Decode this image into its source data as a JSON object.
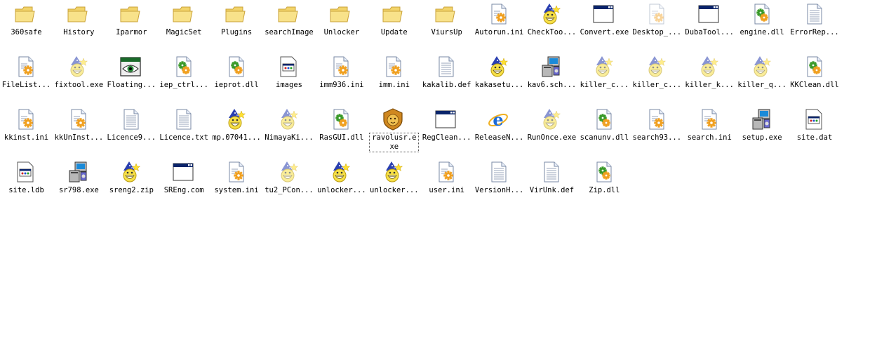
{
  "colors": {
    "folder": "#f2d46a",
    "folder_dark": "#c9a238",
    "window_title": "#0a246a",
    "doc_border": "#7a8aa6",
    "gear": "#f0a020",
    "dll_green": "#3a9a2a",
    "wizard_hat": "#2a3fb0",
    "wizard_face": "#f7e046"
  },
  "items": [
    {
      "label": "360safe",
      "icon": "folder-icon",
      "selected": false
    },
    {
      "label": "History",
      "icon": "folder-icon",
      "selected": false
    },
    {
      "label": "Iparmor",
      "icon": "folder-icon",
      "selected": false
    },
    {
      "label": "MagicSet",
      "icon": "folder-icon",
      "selected": false
    },
    {
      "label": "Plugins",
      "icon": "folder-icon",
      "selected": false
    },
    {
      "label": "searchImage",
      "icon": "folder-icon",
      "selected": false
    },
    {
      "label": "Unlocker",
      "icon": "folder-icon",
      "selected": false
    },
    {
      "label": "Update",
      "icon": "folder-icon",
      "selected": false
    },
    {
      "label": "ViursUp",
      "icon": "folder-icon",
      "selected": false
    },
    {
      "label": "Autorun.ini",
      "icon": "settings-file-icon",
      "selected": false
    },
    {
      "label": "CheckToo...",
      "icon": "wizard-icon",
      "selected": false
    },
    {
      "label": "Convert.exe",
      "icon": "window-exe-icon",
      "selected": false
    },
    {
      "label": "Desktop_...",
      "icon": "settings-file-faded-icon",
      "selected": false
    },
    {
      "label": "DubaTool...",
      "icon": "window-exe-icon",
      "selected": false
    },
    {
      "label": "engine.dll",
      "icon": "dll-icon",
      "selected": false
    },
    {
      "label": "ErrorRep...",
      "icon": "text-file-icon",
      "selected": false
    },
    {
      "label": "FileList...",
      "icon": "settings-file-icon",
      "selected": false
    },
    {
      "label": "fixtool.exe",
      "icon": "wizard-faded-icon",
      "selected": false
    },
    {
      "label": "Floating...",
      "icon": "eye-app-icon",
      "selected": false
    },
    {
      "label": "iep_ctrl...",
      "icon": "dll-icon",
      "selected": false
    },
    {
      "label": "ieprot.dll",
      "icon": "dll-icon",
      "selected": false
    },
    {
      "label": "images",
      "icon": "data-file-icon",
      "selected": false
    },
    {
      "label": "imm936.ini",
      "icon": "settings-file-icon",
      "selected": false
    },
    {
      "label": "imm.ini",
      "icon": "settings-file-icon",
      "selected": false
    },
    {
      "label": "kakalib.def",
      "icon": "text-file-icon",
      "selected": false
    },
    {
      "label": "kakasetu...",
      "icon": "wizard-icon",
      "selected": false
    },
    {
      "label": "kav6.sch...",
      "icon": "installer-icon",
      "selected": false
    },
    {
      "label": "killer_c...",
      "icon": "wizard-faded-icon",
      "selected": false
    },
    {
      "label": "killer_c...",
      "icon": "wizard-faded-icon",
      "selected": false
    },
    {
      "label": "killer_k...",
      "icon": "wizard-faded-icon",
      "selected": false
    },
    {
      "label": "killer_q...",
      "icon": "wizard-faded-icon",
      "selected": false
    },
    {
      "label": "KKClean.dll",
      "icon": "dll-icon",
      "selected": false
    },
    {
      "label": "kkinst.ini",
      "icon": "settings-file-icon",
      "selected": false
    },
    {
      "label": "kkUnInst...",
      "icon": "settings-file-icon",
      "selected": false
    },
    {
      "label": "Licence9...",
      "icon": "text-file-icon",
      "selected": false
    },
    {
      "label": "Licence.txt",
      "icon": "text-file-icon",
      "selected": false
    },
    {
      "label": "mp.07041...",
      "icon": "wizard-icon",
      "selected": false
    },
    {
      "label": "NimayaKi...",
      "icon": "wizard-faded-icon",
      "selected": false
    },
    {
      "label": "RasGUI.dll",
      "icon": "dll-icon",
      "selected": false
    },
    {
      "label": "ravolusr.exe",
      "icon": "lion-shield-icon",
      "selected": true
    },
    {
      "label": "RegClean...",
      "icon": "window-exe-icon",
      "selected": false
    },
    {
      "label": "ReleaseN...",
      "icon": "ie-browser-icon",
      "selected": false
    },
    {
      "label": "RunOnce.exe",
      "icon": "wizard-faded-icon",
      "selected": false
    },
    {
      "label": "scanunv.dll",
      "icon": "dll-icon",
      "selected": false
    },
    {
      "label": "search93...",
      "icon": "settings-file-icon",
      "selected": false
    },
    {
      "label": "search.ini",
      "icon": "settings-file-icon",
      "selected": false
    },
    {
      "label": "setup.exe",
      "icon": "installer-icon",
      "selected": false
    },
    {
      "label": "site.dat",
      "icon": "data-file-icon",
      "selected": false
    },
    {
      "label": "site.ldb",
      "icon": "data-file-icon",
      "selected": false
    },
    {
      "label": "sr798.exe",
      "icon": "installer-icon",
      "selected": false
    },
    {
      "label": "sreng2.zip",
      "icon": "wizard-icon",
      "selected": false
    },
    {
      "label": "SREng.com",
      "icon": "window-exe-icon",
      "selected": false
    },
    {
      "label": "system.ini",
      "icon": "settings-file-icon",
      "selected": false
    },
    {
      "label": "tu2_PCon...",
      "icon": "wizard-faded-icon",
      "selected": false
    },
    {
      "label": "unlocker...",
      "icon": "wizard-icon",
      "selected": false
    },
    {
      "label": "unlocker...",
      "icon": "wizard-icon",
      "selected": false
    },
    {
      "label": "user.ini",
      "icon": "settings-file-icon",
      "selected": false
    },
    {
      "label": "VersionH...",
      "icon": "text-file-icon",
      "selected": false
    },
    {
      "label": "VirUnk.def",
      "icon": "text-file-icon",
      "selected": false
    },
    {
      "label": "Zip.dll",
      "icon": "dll-icon",
      "selected": false
    }
  ]
}
